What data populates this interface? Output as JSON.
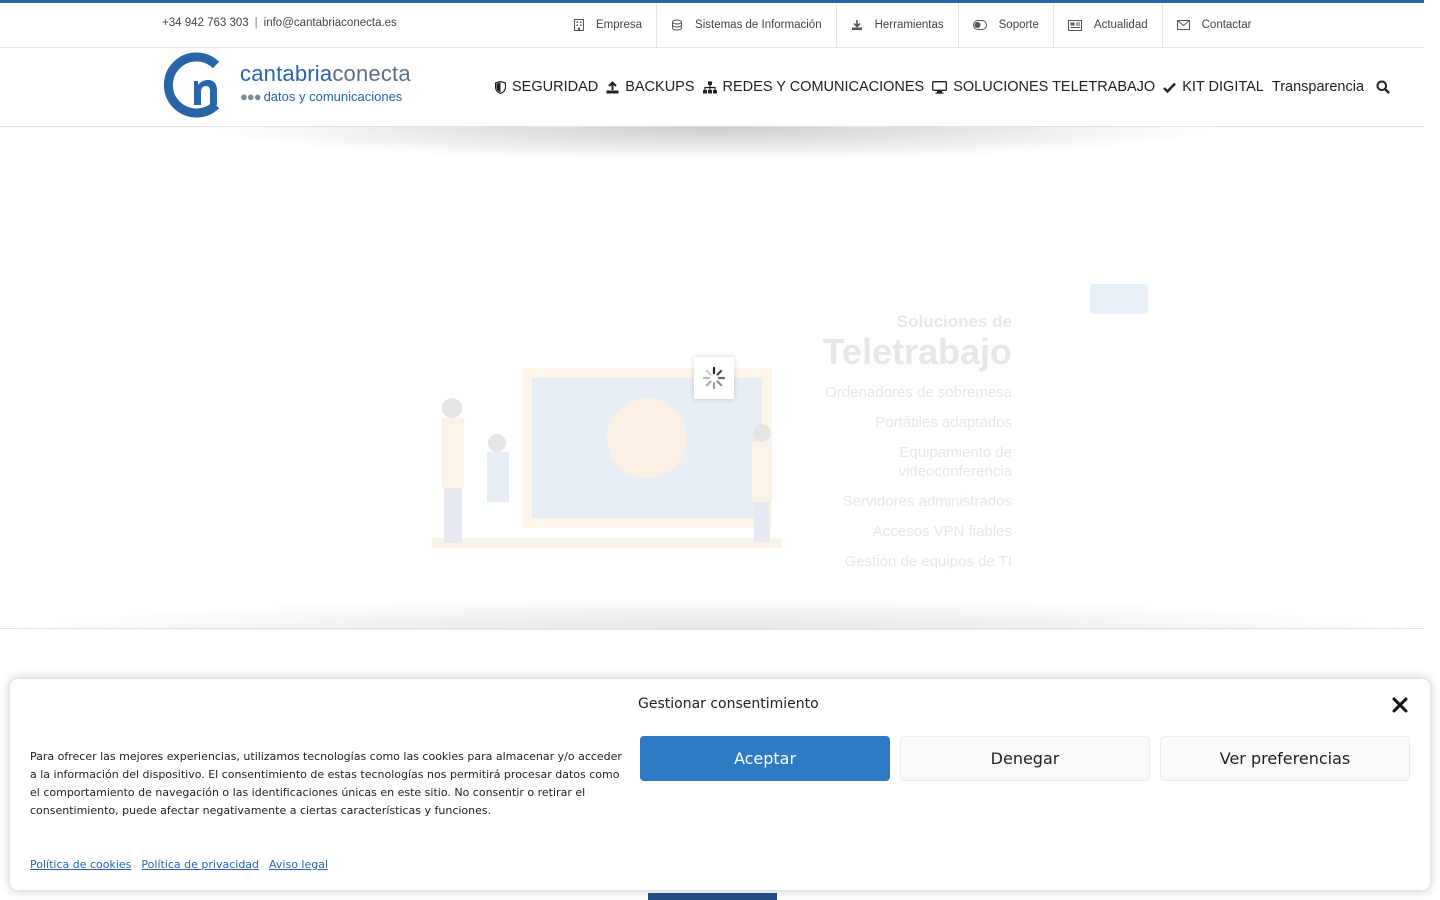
{
  "topbar": {
    "phone": "+34 942 763 303",
    "separator": "|",
    "email": "info@cantabriaconecta.es",
    "nav": [
      {
        "label": "Empresa",
        "icon": "building-icon"
      },
      {
        "label": "Sistemas de Información",
        "icon": "database-icon"
      },
      {
        "label": "Herramientas",
        "icon": "download-icon"
      },
      {
        "label": "Soporte",
        "icon": "toggle-icon"
      },
      {
        "label": "Actualidad",
        "icon": "newspaper-icon"
      },
      {
        "label": "Contactar",
        "icon": "envelope-icon"
      }
    ]
  },
  "logo": {
    "brand_primary": "cantabria",
    "brand_secondary": "conecta",
    "dots": "●●●",
    "tagline": "datos y comunicaciones"
  },
  "mainnav": [
    {
      "label": "SEGURIDAD",
      "icon": "shield-icon"
    },
    {
      "label": "BACKUPS",
      "icon": "upload-icon"
    },
    {
      "label": "REDES Y COMUNICACIONES",
      "icon": "sitemap-icon"
    },
    {
      "label": "SOLUCIONES TELETRABAJO",
      "icon": "desktop-icon"
    },
    {
      "label": "KIT DIGITAL",
      "icon": "check-icon"
    },
    {
      "label": "Transparencia",
      "icon": ""
    }
  ],
  "hero": {
    "pre_title": "Soluciones de",
    "title": "Teletrabajo",
    "lines": [
      "Ordenadores de sobremesa",
      "Portátiles adaptados",
      "Equipamiento de videoconferencia",
      "Servidores administrados",
      "Accesos VPN fiables",
      "Gestión de equipos de TI"
    ]
  },
  "consent": {
    "title": "Gestionar consentimiento",
    "message": "Para ofrecer las mejores experiencias, utilizamos tecnologías como las cookies para almacenar y/o acceder a la información del dispositivo. El consentimiento de estas tecnologías nos permitirá procesar datos como el comportamiento de navegación o las identificaciones únicas en este sitio. No consentir o retirar el consentimiento, puede afectar negativamente a ciertas características y funciones.",
    "accept": "Aceptar",
    "deny": "Denegar",
    "preferences": "Ver preferencias",
    "links": [
      "Política de cookies",
      "Política de privacidad",
      "Aviso legal"
    ]
  },
  "colors": {
    "brand_blue": "#2a64a8",
    "accept_blue": "#2e7bc4",
    "brand_gray": "#5f6f7f"
  }
}
